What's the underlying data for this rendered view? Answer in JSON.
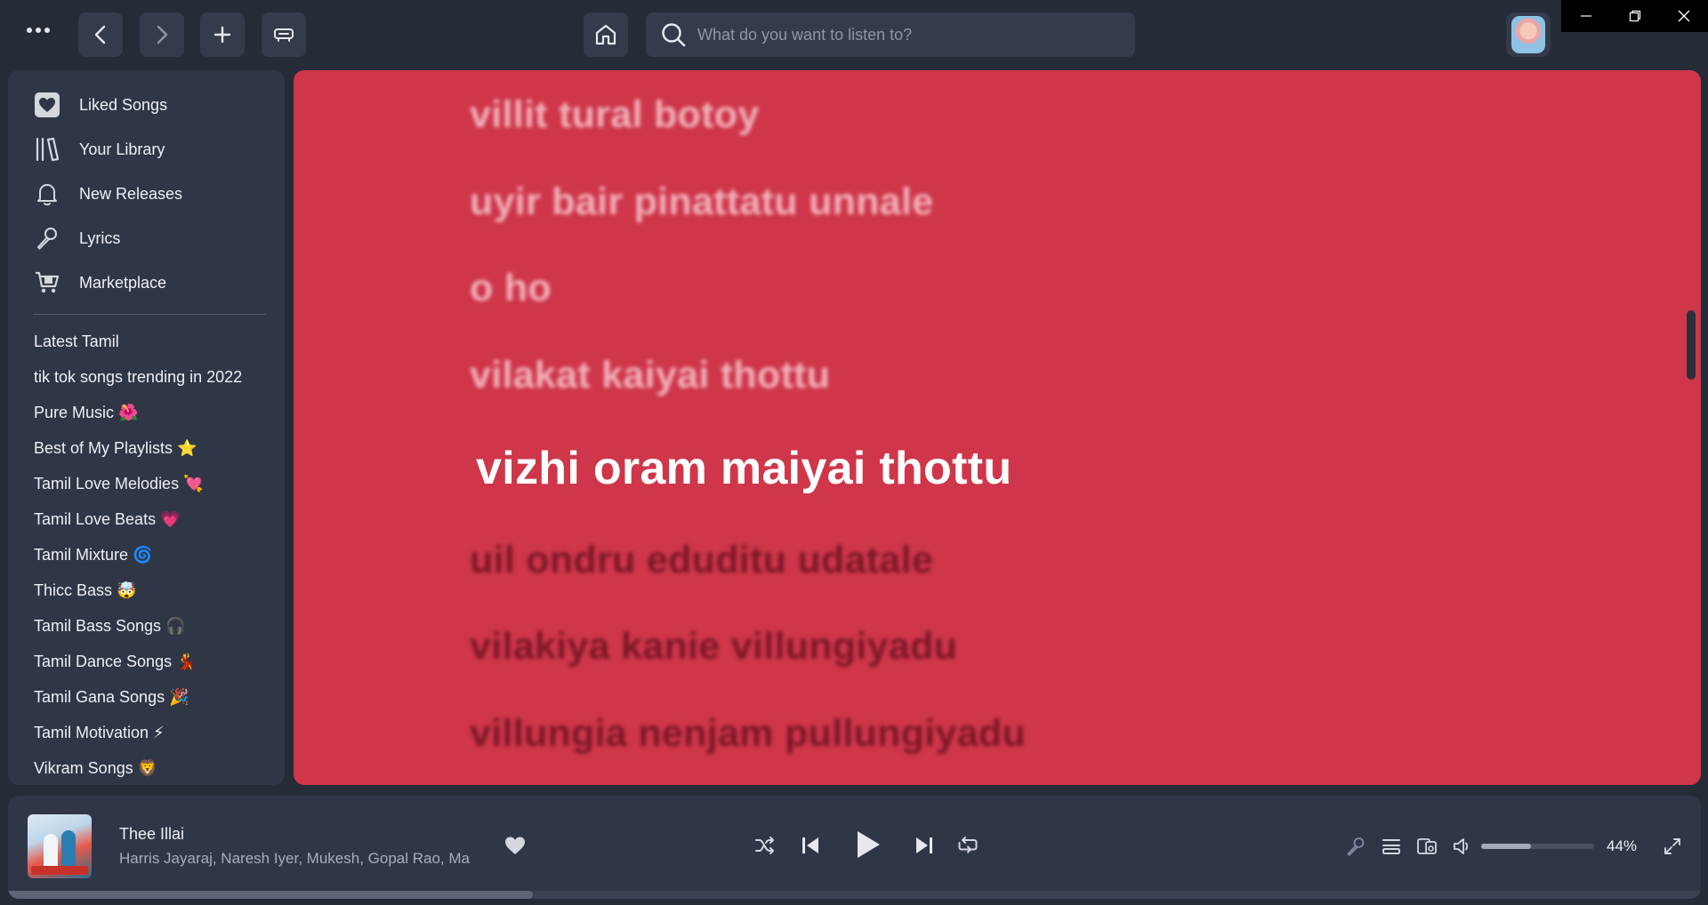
{
  "topbar": {
    "search_placeholder": "What do you want to listen to?"
  },
  "icons": {
    "menu": "more-dots",
    "back": "chevron-left",
    "forward": "chevron-right",
    "add": "plus",
    "mini_player": "mini-player",
    "home": "home",
    "search": "magnifier",
    "window_minimize": "minimize",
    "window_restore": "restore",
    "window_close": "close"
  },
  "sidebar": {
    "nav": [
      {
        "label": "Liked Songs",
        "icon": "heart-icon"
      },
      {
        "label": "Your Library",
        "icon": "library-icon"
      },
      {
        "label": "New Releases",
        "icon": "bell-icon"
      },
      {
        "label": "Lyrics",
        "icon": "microphone-icon"
      },
      {
        "label": "Marketplace",
        "icon": "cart-icon"
      }
    ],
    "playlists": [
      "Latest Tamil",
      "tik tok songs trending in 2022",
      "Pure Music 🌺",
      "Best of My Playlists ⭐",
      "Tamil Love Melodies 💘",
      "Tamil Love Beats 💗",
      "Tamil Mixture 🌀",
      "Thicc Bass 🤯",
      "Tamil Bass Songs 🎧",
      "Tamil Dance Songs 💃",
      "Tamil Gana Songs 🎉",
      "Tamil Motivation ⚡",
      "Vikram Songs 🦁"
    ]
  },
  "lyrics": {
    "background": "#cf364a",
    "lines": [
      {
        "text": "villit tural botoy",
        "state": "past"
      },
      {
        "text": "uyir bair pinattatu unnale",
        "state": "past"
      },
      {
        "text": "o ho",
        "state": "past"
      },
      {
        "text": "vilakat kaiyai thottu",
        "state": "past"
      },
      {
        "text": "vizhi oram maiyai thottu",
        "state": "current"
      },
      {
        "text": "uil ondru eduditu udatale",
        "state": "future"
      },
      {
        "text": "vilakiya kanie villungiyadu",
        "state": "future"
      },
      {
        "text": "villungia nenjam pullungiyadu",
        "state": "future"
      }
    ]
  },
  "player": {
    "track_title": "Thee Illai",
    "artists": "Harris Jayaraj, Naresh Iyer, Mukesh, Gopal Rao, Ma",
    "volume_percent": 44,
    "volume_label": "44%",
    "progress_fraction": 0.31,
    "liked": true
  }
}
